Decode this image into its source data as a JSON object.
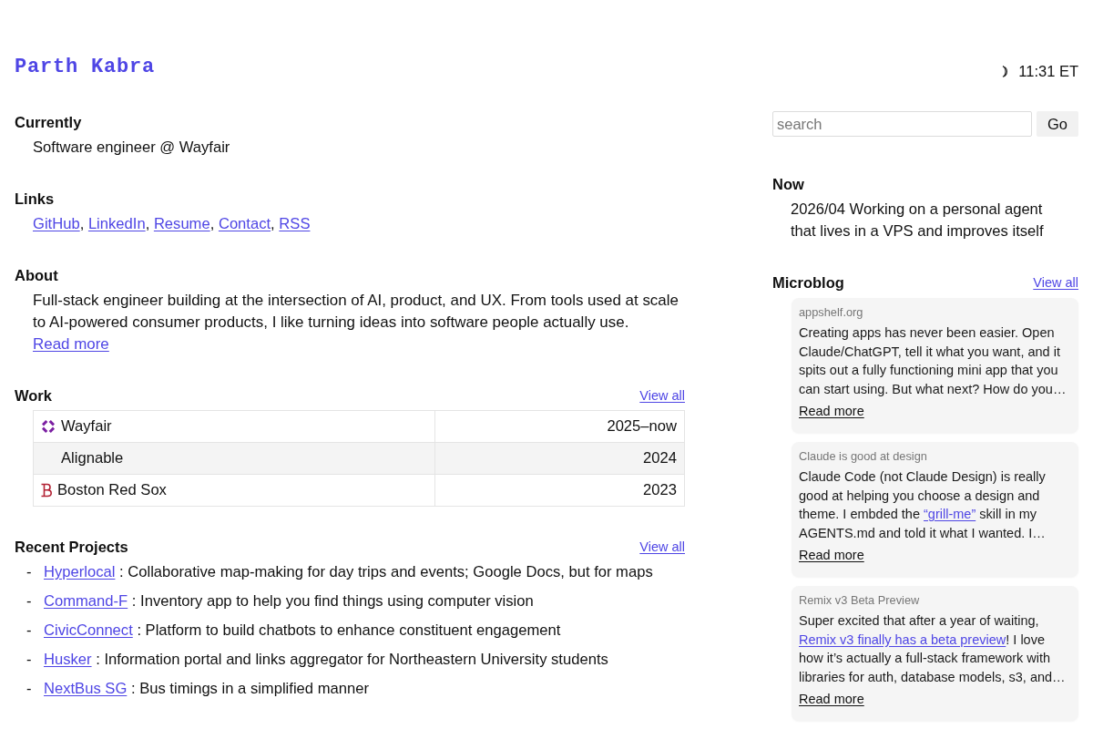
{
  "header": {
    "title": "Parth Kabra",
    "clock": "11:31 ET"
  },
  "currently": {
    "heading": "Currently",
    "text": "Software engineer @ Wayfair"
  },
  "links": {
    "heading": "Links",
    "items": [
      {
        "label": "GitHub",
        "separator": ","
      },
      {
        "label": "LinkedIn",
        "separator": ","
      },
      {
        "label": "Resume",
        "separator": ","
      },
      {
        "label": "Contact",
        "separator": ","
      },
      {
        "label": "RSS"
      }
    ]
  },
  "about": {
    "heading": "About",
    "text": "Full-stack engineer building at the intersection of AI, product, and UX. From tools used at scale to AI-powered consumer products, I like turning ideas into software people actually use.",
    "link": "Read more"
  },
  "work": {
    "heading": "Work",
    "view_all": "View all",
    "rows": [
      {
        "kind": "pinwheel",
        "company": "Wayfair",
        "years": "2025–now"
      },
      {
        "kind": "plain",
        "company": "Alignable",
        "years": "2024"
      },
      {
        "kind": "monogram",
        "company": "Boston Red Sox",
        "years": "2023"
      }
    ]
  },
  "recent_projects": {
    "heading": "Recent Projects",
    "view_all": "View all",
    "items": [
      {
        "bullet": "-",
        "name": "Hyperlocal",
        "description": ": Collaborative map-making for day trips and events; Google Docs, but for maps"
      },
      {
        "bullet": "-",
        "name": "Command-F",
        "description": ": Inventory app to help you find things using computer vision"
      },
      {
        "bullet": "-",
        "name": "CivicConnect",
        "description": ": Platform to build chatbots to enhance constituent engagement"
      },
      {
        "bullet": "-",
        "name": "Husker",
        "description": ": Information portal and links aggregator for Northeastern University students"
      },
      {
        "bullet": "-",
        "name": "NextBus SG",
        "description": ": Bus timings in a simplified manner"
      }
    ]
  },
  "search": {
    "placeholder": "search",
    "button": "Go"
  },
  "now": {
    "heading": "Now",
    "text": "2026/04 Working on a personal agent that lives in a VPS and improves itself"
  },
  "microblog": {
    "heading": "Microblog",
    "view_all": "View all",
    "posts": [
      {
        "source": "appshelf.org",
        "body": [
          {
            "kind": "text",
            "text": "Creating apps has never been easier. Open Claude/ChatGPT, tell it what you want, and it spits out a fully functioning mini app that you can start using. But what next? How do you…"
          }
        ],
        "read_more": "Read more"
      },
      {
        "source": "Claude is good at design",
        "body": [
          {
            "kind": "text",
            "text": "Claude Code (not Claude Design) is really good at helping you choose a design and theme. I embded the "
          },
          {
            "kind": "link",
            "text": "“grill-me”"
          },
          {
            "kind": "text",
            "text": " skill in my AGENTS.md and told it what I wanted. I…"
          }
        ],
        "read_more": "Read more"
      },
      {
        "source": "Remix v3 Beta Preview",
        "body": [
          {
            "kind": "text",
            "text": "Super excited that after a year of waiting, "
          },
          {
            "kind": "link",
            "text": "Remix v3 finally has a beta preview"
          },
          {
            "kind": "text",
            "text": "! I love how it’s actually a full-stack framework with libraries for auth, database models, s3, and…"
          }
        ],
        "read_more": "Read more"
      }
    ]
  }
}
